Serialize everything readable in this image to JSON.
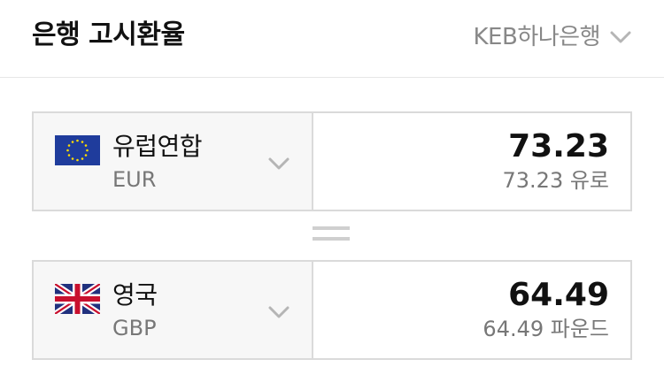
{
  "header": {
    "title": "은행 고시환율",
    "bank_selector": {
      "label": "KEB하나은행",
      "icon": "chevron-down-icon"
    }
  },
  "from_currency": {
    "country": "유럽연합",
    "code": "EUR",
    "flag_icon": "eu-flag-icon",
    "amount": "73.23",
    "amount_description": "73.23 유로"
  },
  "equals_icon": "equals-icon",
  "to_currency": {
    "country": "영국",
    "code": "GBP",
    "flag_icon": "uk-flag-icon",
    "amount": "64.49",
    "amount_description": "64.49 파운드"
  },
  "colors": {
    "text_primary": "#111111",
    "text_secondary": "#777777",
    "border": "#dadada",
    "select_bg": "#f7f7f7",
    "eu_blue": "#1f3c9c",
    "eu_star": "#ffdd00",
    "uk_blue": "#21317e",
    "uk_red": "#c8102e"
  }
}
